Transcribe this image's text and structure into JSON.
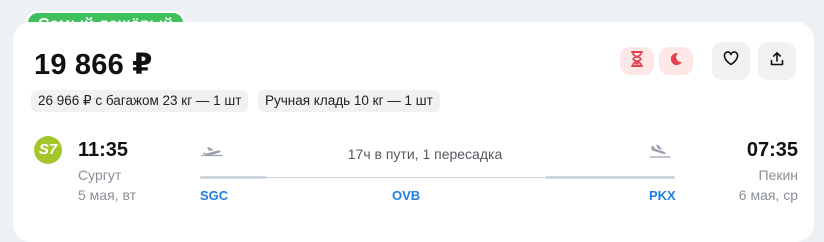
{
  "badge": "Самый дешёвый",
  "price": "19 866 ₽",
  "tags": [
    "26 966 ₽ с багажом 23 кг — 1 шт",
    "Ручная кладь 10 кг — 1 шт"
  ],
  "icons": {
    "hourglass": "hourglass-icon",
    "night": "moon-icon",
    "favorite": "heart-icon",
    "share": "share-icon",
    "airline": "S7"
  },
  "colors": {
    "badge": "#3fc05c",
    "warning": "#e0424f",
    "warning_bg": "#fde7e7",
    "iata": "#1f7fe0",
    "airline": "#a3c72b"
  },
  "flight": {
    "departure": {
      "time": "11:35",
      "city": "Сургут",
      "date": "5 мая, вт"
    },
    "arrival": {
      "time": "07:35",
      "city": "Пекин",
      "date": "6 мая, ср"
    },
    "duration": "17ч в пути, 1 пересадка",
    "airports": [
      "SGC",
      "OVB",
      "PKX"
    ]
  }
}
